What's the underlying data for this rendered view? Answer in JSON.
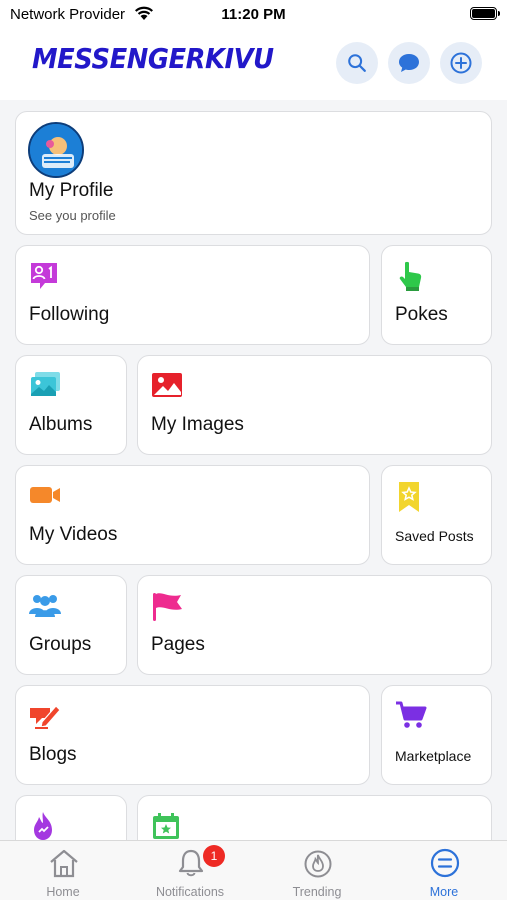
{
  "status_bar": {
    "carrier": "Network Provider",
    "time": "11:20 PM"
  },
  "header": {
    "logo_text": "MESSENGERKIVU",
    "buttons": [
      {
        "name": "search-button",
        "icon": "search-icon"
      },
      {
        "name": "messages-button",
        "icon": "chat-bubble-icon"
      },
      {
        "name": "add-button",
        "icon": "plus-circle-icon"
      }
    ]
  },
  "menu": {
    "profile": {
      "label": "My Profile",
      "subtitle": "See you profile"
    },
    "following": {
      "label": "Following",
      "icon": "follow-user-icon",
      "color": "#c43ad9"
    },
    "pokes": {
      "label": "Pokes",
      "icon": "hand-pointer-icon",
      "color": "#2ec84a"
    },
    "albums": {
      "label": "Albums",
      "icon": "album-icon",
      "color": "#3cc5d8"
    },
    "my_images": {
      "label": "My Images",
      "icon": "image-icon",
      "color": "#e6212b"
    },
    "my_videos": {
      "label": "My Videos",
      "icon": "video-camera-icon",
      "color": "#f5882a"
    },
    "saved_posts": {
      "label": "Saved Posts",
      "icon": "bookmark-star-icon",
      "color": "#f2d52e"
    },
    "groups": {
      "label": "Groups",
      "icon": "groups-icon",
      "color": "#3a9be8"
    },
    "pages": {
      "label": "Pages",
      "icon": "flag-icon",
      "color": "#ee2b8f"
    },
    "blogs": {
      "label": "Blogs",
      "icon": "blog-pen-icon",
      "color": "#f0452c"
    },
    "marketplace": {
      "label": "Marketplace",
      "icon": "cart-icon",
      "color": "#7b2fe3"
    },
    "partial_left": {
      "icon": "fire-icon",
      "color": "#a438e0"
    },
    "partial_right": {
      "icon": "calendar-star-icon",
      "color": "#3fc35a"
    }
  },
  "tabbar": {
    "tabs": [
      {
        "label": "Home",
        "icon": "home-icon"
      },
      {
        "label": "Notifications",
        "icon": "bell-icon",
        "badge": "1"
      },
      {
        "label": "Trending",
        "icon": "trending-fire-icon"
      },
      {
        "label": "More",
        "icon": "more-menu-icon",
        "active": true
      }
    ]
  },
  "colors": {
    "accent": "#2d72d9",
    "logo": "#2218c9",
    "badge": "#ee2a24"
  }
}
